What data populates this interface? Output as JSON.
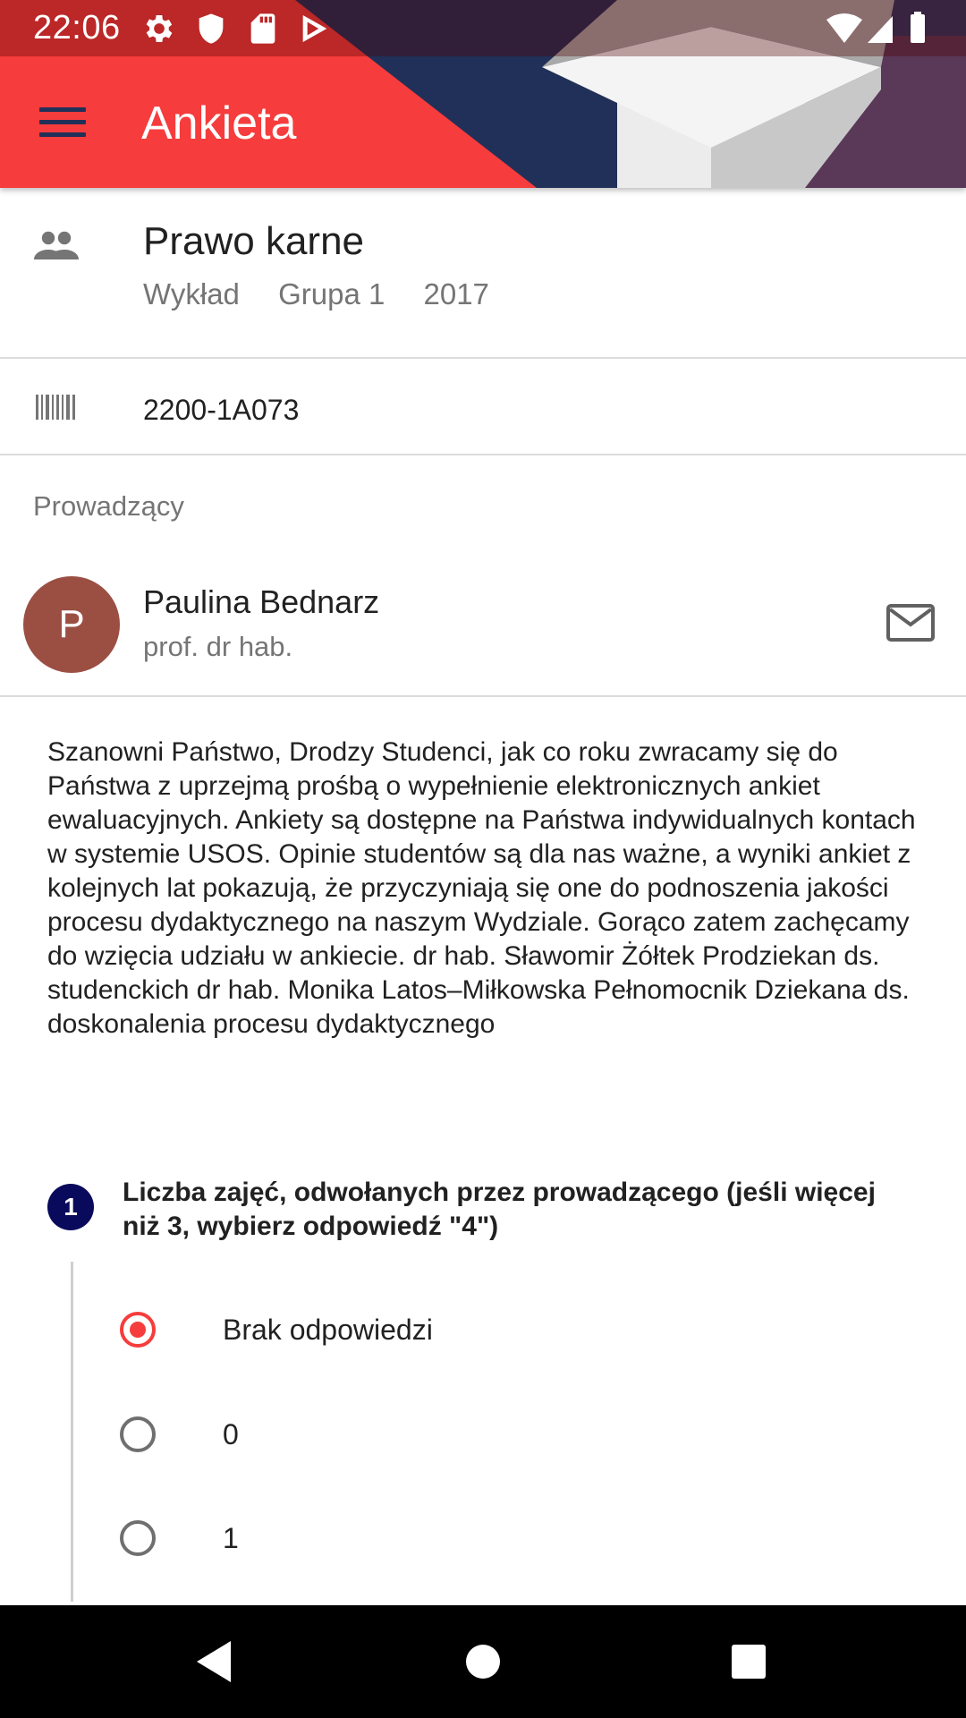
{
  "status_bar": {
    "time": "22:06",
    "left_icons": [
      "gear-icon",
      "shield-icon",
      "sd-card-icon",
      "play-store-icon"
    ],
    "right_icons": [
      "wifi-icon",
      "signal-icon",
      "battery-icon"
    ]
  },
  "toolbar": {
    "menu_icon": "hamburger-menu-icon",
    "title": "Ankieta",
    "accent_color": "#F63C3C"
  },
  "course": {
    "icon": "people-icon",
    "name": "Prawo karne",
    "type": "Wykład",
    "group": "Grupa 1",
    "year": "2017"
  },
  "code": {
    "icon": "barcode-icon",
    "value": "2200-1A073"
  },
  "lecturers": {
    "section_label": "Prowadzący",
    "items": [
      {
        "avatar_letter": "P",
        "avatar_color": "#9B4F43",
        "name": "Paulina Bednarz",
        "title": "prof. dr hab.",
        "action_icon": "mail-icon"
      }
    ]
  },
  "intro_text": "Szanowni Państwo, Drodzy Studenci, jak co roku zwracamy się do Państwa z uprzejmą prośbą o wypełnienie elektronicznych ankiet ewaluacyjnych. Ankiety są dostępne na Państwa indywidualnych kontach w systemie USOS. Opinie studentów są dla nas ważne, a wyniki ankiet z kolejnych lat pokazują, że przyczyniają się one do podnoszenia jakości procesu dydaktycznego na naszym Wydziale. Gorąco zatem zachęcamy do wzięcia udziału w ankiecie. dr hab. Sławomir Żółtek Prodziekan ds. studenckich dr hab. Monika Latos–Miłkowska Pełnomocnik Dziekana ds. doskonalenia procesu dydaktycznego",
  "question": {
    "number": "1",
    "text": "Liczba zajęć, odwołanych przez prowadzącego (jeśli więcej niż 3, wybierz odpowiedź \"4\")",
    "options": [
      {
        "label": "Brak odpowiedzi",
        "selected": true
      },
      {
        "label": "0",
        "selected": false
      },
      {
        "label": "1",
        "selected": false
      }
    ]
  },
  "nav_bar": {
    "icons": [
      "back-icon",
      "home-icon",
      "recents-icon"
    ]
  }
}
